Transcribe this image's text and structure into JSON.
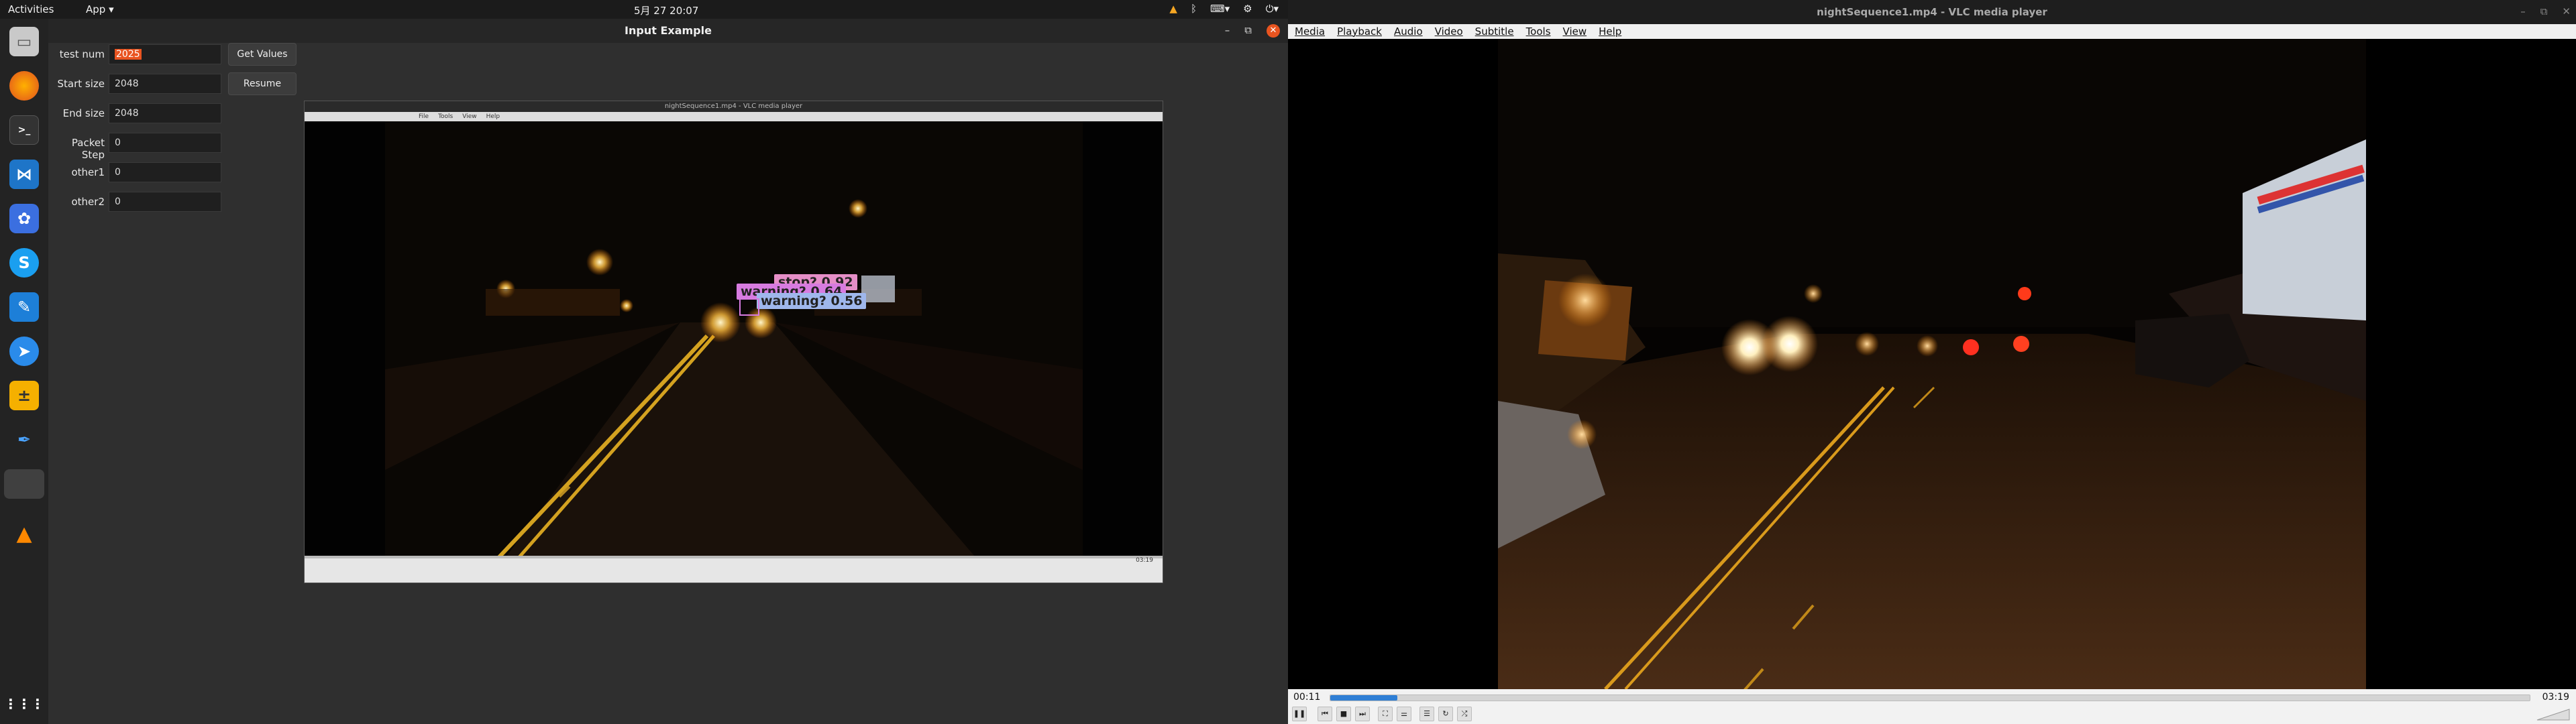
{
  "topbar": {
    "activities": "Activities",
    "app_menu": "App ▾",
    "clock": "5月 27  20:07"
  },
  "input_window": {
    "title": "Input Example",
    "fields": [
      {
        "label": "test num",
        "value": "2025"
      },
      {
        "label": "Start size",
        "value": "2048"
      },
      {
        "label": "End size",
        "value": "2048"
      },
      {
        "label": "Packet Step",
        "value": "0"
      },
      {
        "label": "other1",
        "value": "0"
      },
      {
        "label": "other2",
        "value": "0"
      }
    ],
    "get_values_label": "Get Values",
    "resume_label": "Resume"
  },
  "mini_vlc": {
    "title": "nightSequence1.mp4 - VLC media player",
    "menu": [
      "File",
      "Tools",
      "View",
      "Help"
    ],
    "time_end": "03:19",
    "detections": [
      {
        "label": "stop?  0.92"
      },
      {
        "label": "warning?  0.64"
      },
      {
        "label": "warning?  0.56"
      }
    ]
  },
  "vlc": {
    "title": "nightSequence1.mp4 - VLC media player",
    "menu": [
      "Media",
      "Playback",
      "Audio",
      "Video",
      "Subtitle",
      "Tools",
      "View",
      "Help"
    ],
    "time_current": "00:11",
    "time_end": "03:19",
    "progress": 0.056
  },
  "colors": {
    "accent": "#e95420",
    "vlc_progress": "#2f7fd5"
  }
}
